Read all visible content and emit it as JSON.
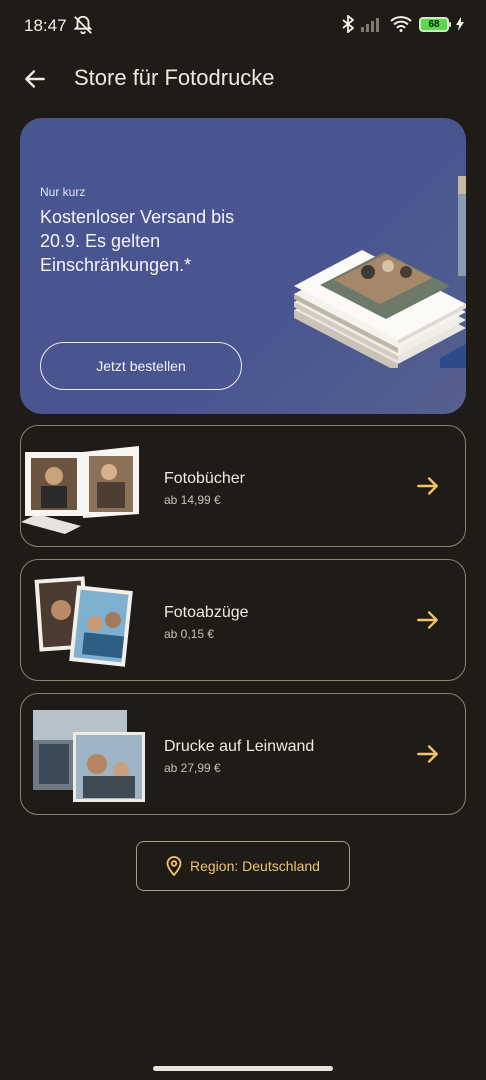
{
  "status": {
    "time": "18:47",
    "battery": "68"
  },
  "header": {
    "title": "Store für Fotodrucke"
  },
  "banner": {
    "eyebrow": "Nur kurz",
    "headline": "Kostenloser Versand bis 20.9. Es gelten Einschränkungen.*",
    "cta": "Jetzt bestellen"
  },
  "products": [
    {
      "name": "Fotobücher",
      "price": "ab 14,99 €"
    },
    {
      "name": "Fotoabzüge",
      "price": "ab 0,15 €"
    },
    {
      "name": "Drucke auf Leinwand",
      "price": "ab 27,99 €"
    }
  ],
  "region": {
    "label": "Region: Deutschland"
  },
  "colors": {
    "background": "#1f1c17",
    "accent": "#f1c46a",
    "banner": "#4a5590",
    "card_border": "#8a8270"
  }
}
